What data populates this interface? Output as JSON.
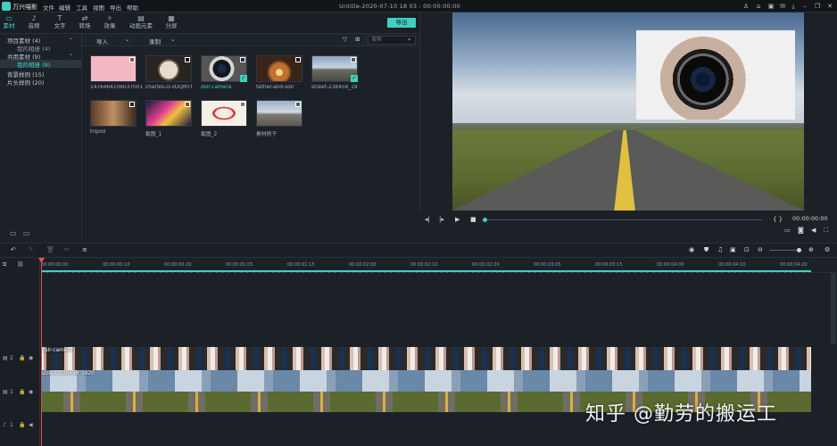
{
  "app": {
    "name": "万兴喵影",
    "doc_title": "Untitle-2020-07-10 18 03 : 00:00:00:00"
  },
  "menu": [
    "文件",
    "编辑",
    "工具",
    "视图",
    "导出",
    "帮助"
  ],
  "toolbar": {
    "tabs": [
      {
        "label": "素材",
        "icon": "folder-icon"
      },
      {
        "label": "音频",
        "icon": "music-icon"
      },
      {
        "label": "文字",
        "icon": "text-icon"
      },
      {
        "label": "转场",
        "icon": "transition-icon"
      },
      {
        "label": "效果",
        "icon": "effects-icon"
      },
      {
        "label": "动画元素",
        "icon": "elements-icon"
      },
      {
        "label": "分屏",
        "icon": "split-screen-icon"
      }
    ],
    "export_label": "导出"
  },
  "sidebar": {
    "items": [
      {
        "label": "项目素材 (4)"
      },
      {
        "label": "我的相册 (4)"
      },
      {
        "label": "共用素材 (9)"
      },
      {
        "label": "我的相册 (9)"
      },
      {
        "label": "背景样例 (15)"
      },
      {
        "label": "片头样例 (20)"
      }
    ]
  },
  "media_toolbar": {
    "import_label": "导入",
    "record_label": "录制",
    "search_placeholder": "搜索"
  },
  "media": [
    {
      "label": "1476464106037001",
      "checked": false,
      "kind": "pink"
    },
    {
      "label": "charles-D-vDQMTf",
      "checked": false,
      "kind": "watch"
    },
    {
      "label": "dslr-camera",
      "checked": true,
      "kind": "camera"
    },
    {
      "label": "father-and-son",
      "checked": false,
      "kind": "sunset"
    },
    {
      "label": "street-238458_19",
      "checked": true,
      "kind": "road"
    },
    {
      "label": "tripod",
      "checked": false,
      "kind": "tripod"
    },
    {
      "label": "截图_1",
      "checked": false,
      "kind": "colorful"
    },
    {
      "label": "截图_2",
      "checked": false,
      "kind": "manga"
    },
    {
      "label": "素材例子",
      "checked": false,
      "kind": "street"
    }
  ],
  "preview": {
    "timecode": "00:00:00:00"
  },
  "timeline": {
    "ruler": [
      "00:00:00:00",
      "00:00:00:10",
      "00:00:00:20",
      "00:00:01:05",
      "00:00:01:15",
      "00:00:02:00",
      "00:00:02:10",
      "00:00:02:20",
      "00:00:03:05",
      "00:00:03:15",
      "00:00:04:00",
      "00:00:04:10",
      "00:00:04:20"
    ],
    "tracks": [
      {
        "label": "2",
        "clip": "dslr-camera"
      },
      {
        "label": "1",
        "clip": "street-238458_1920"
      },
      {
        "label": "1",
        "clip": ""
      }
    ]
  },
  "watermark": "知乎 @勤劳的搬运工",
  "colors": {
    "accent": "#3fd0c0",
    "playhead": "#e0524d"
  }
}
